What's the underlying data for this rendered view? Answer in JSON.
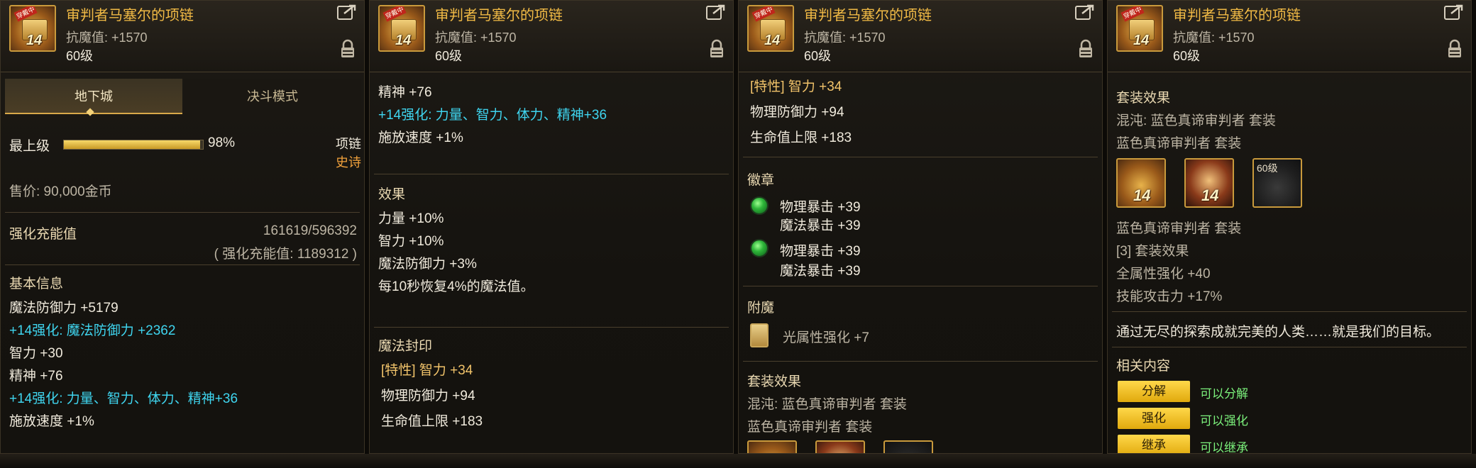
{
  "item": {
    "name": "审判者马塞尔的项链",
    "resist_label": "抗魔值: +1570",
    "level_label": "60级",
    "reinforce_level": "14",
    "ribbon_text": "穿戴中"
  },
  "tabs": [
    "地下城",
    "决斗模式"
  ],
  "rarity": {
    "label": "最上级",
    "percent_text": "98%",
    "percent": 0.98
  },
  "item_type": {
    "slot": "项链",
    "grade": "史诗"
  },
  "price": "售价: 90,000金币",
  "reinforce_charge": {
    "label": "强化充能值",
    "value": "161619/596392",
    "sub": "( 强化充能值: 1189312 )"
  },
  "basic_info": {
    "title": "基本信息",
    "lines": [
      "魔法防御力 +5179",
      "+14强化: 魔法防御力 +2362",
      "智力 +30",
      "精神 +76",
      "+14强化: 力量、智力、体力、精神+36",
      "施放速度 +1%"
    ]
  },
  "panel2": {
    "lines": [
      "精神 +76",
      "+14强化: 力量、智力、体力、精神+36",
      "施放速度 +1%"
    ],
    "effect_title": "效果",
    "effects": [
      "力量 +10%",
      "智力 +10%",
      "魔法防御力 +3%",
      "每10秒恢复4%的魔法值。"
    ],
    "seal_title": "魔法封印",
    "seal_trait": "[特性] 智力 +34",
    "seal_lines": [
      "物理防御力 +94",
      "生命值上限 +183"
    ]
  },
  "panel3": {
    "trait": "[特性] 智力 +34",
    "lines": [
      "物理防御力 +94",
      "生命值上限 +183"
    ],
    "emblem_title": "徽章",
    "emblems": [
      [
        "物理暴击 +39",
        "魔法暴击 +39"
      ],
      [
        "物理暴击 +39",
        "魔法暴击 +39"
      ]
    ],
    "enchant_title": "附魔",
    "enchant": "光属性强化 +7",
    "set_title": "套装效果",
    "set_chaos": "混沌: 蓝色真谛审判者 套装",
    "set_name": "蓝色真谛审判者 套装"
  },
  "panel4": {
    "set_title": "套装效果",
    "set_chaos": "混沌: 蓝色真谛审判者 套装",
    "set_name": "蓝色真谛审判者 套装",
    "set_icons": [
      "14",
      "14",
      "60级"
    ],
    "set_name2": "蓝色真谛审判者 套装",
    "set_bonus_title": "[3] 套装效果",
    "set_bonus_lines": [
      "全属性强化 +40",
      "技能攻击力 +17%"
    ],
    "flavor": "通过无尽的探索成就完美的人类……就是我们的目标。",
    "related_title": "相关内容",
    "related": [
      {
        "button": "分解",
        "text": "可以分解"
      },
      {
        "button": "强化",
        "text": "可以强化"
      },
      {
        "button": "继承",
        "text": "可以继承"
      }
    ]
  }
}
